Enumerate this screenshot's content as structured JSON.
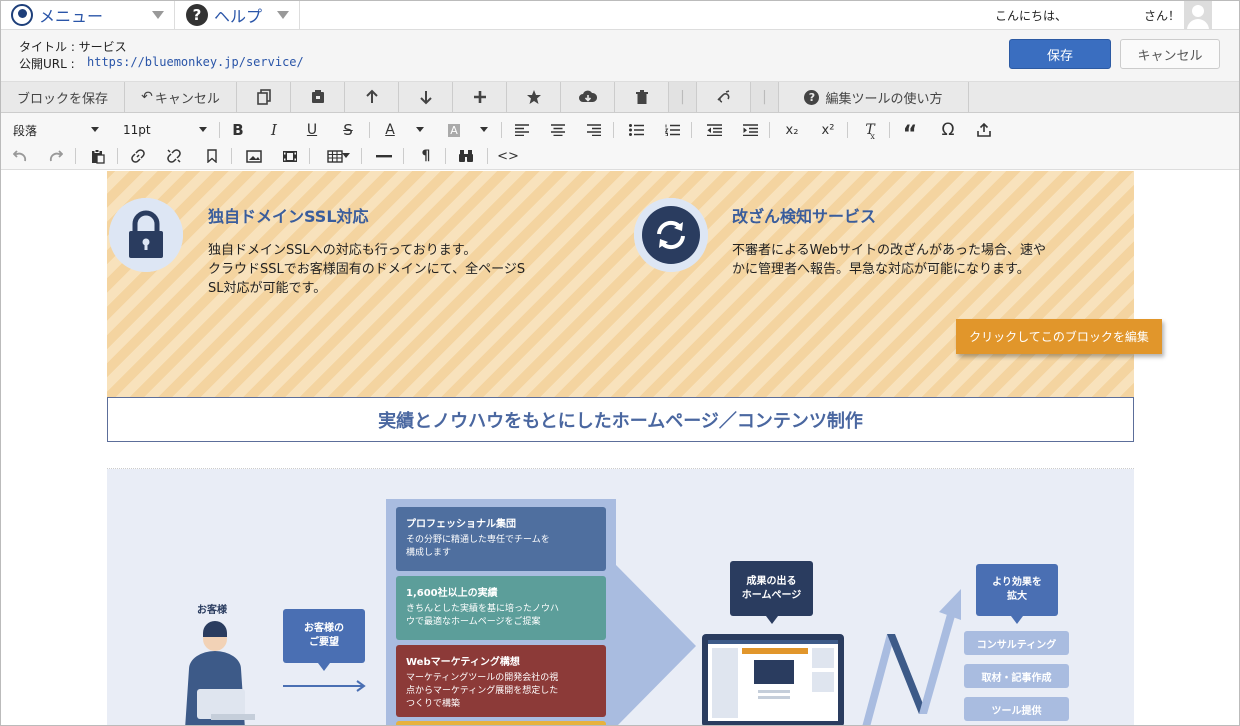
{
  "topbar": {
    "menu_label": "メニュー",
    "help_label": "ヘルプ",
    "greeting": "こんにちは、",
    "greeting_suffix": "さん！"
  },
  "page_info": {
    "title_text": "タイトル : サービス",
    "url_label": "公開URL :",
    "url": "https://bluemonkey.jp/service/",
    "save_label": "保存",
    "cancel_label": "キャンセル"
  },
  "block_toolbar": {
    "save_block_label": "ブロックを保存",
    "cancel_label": "キャンセル",
    "help_label": "編集ツールの使い方",
    "icons": [
      "copy-icon",
      "save-template-icon",
      "arrow-up-icon",
      "arrow-down-icon",
      "plus-icon",
      "star-icon",
      "cloud-download-icon",
      "trash-icon",
      "unlink-icon"
    ]
  },
  "editor_toolbar": {
    "paragraph_select": "段落",
    "size_select": "11pt",
    "row1": [
      "B",
      "I",
      "U",
      "S",
      "A",
      "A",
      "x₂",
      "x²",
      "Ω"
    ],
    "row2": [
      "¶"
    ]
  },
  "content": {
    "feature1": {
      "title": "独自ドメインSSL対応",
      "line1": "独自ドメインSSLへの対応も行っております。",
      "line2": "クラウドSSLでお客様固有のドメインにて、全ページS",
      "line3": "SL対応が可能です。"
    },
    "feature2": {
      "title": "改ざん検知サービス",
      "line1": "不審者によるWebサイトの改ざんがあった場合、速や",
      "line2": "かに管理者へ報告。早急な対応が可能になります。"
    },
    "edit_badge": "クリックしてこのブロックを編集",
    "heading": "実績とノウハウをもとにしたホームページ／コンテンツ制作",
    "diagram": {
      "customer_label": "お客様",
      "request_bubble": "お客様の\nご要望",
      "cards": [
        {
          "title": "プロフェッショナル集団",
          "body": "その分野に精通した専任でチームを\n構成します",
          "color": "#4f6f9f"
        },
        {
          "title": "1,600社以上の実績",
          "body": "きちんとした実績を基に培ったノウハ\nウで最適なホームページをご提案",
          "color": "#5c9e9a"
        },
        {
          "title": "Webマーケティング構想",
          "body": "マーケティングツールの開発会社の視\n点からマーケティング展開を想定した\nつくりで構築",
          "color": "#8c3a38"
        }
      ],
      "result_bubble": "成果の出る\nホームページ",
      "effect_bubble": "より効果を\n拡大",
      "pills": [
        "コンサルティング",
        "取材・記事作成",
        "ツール提供"
      ]
    }
  }
}
